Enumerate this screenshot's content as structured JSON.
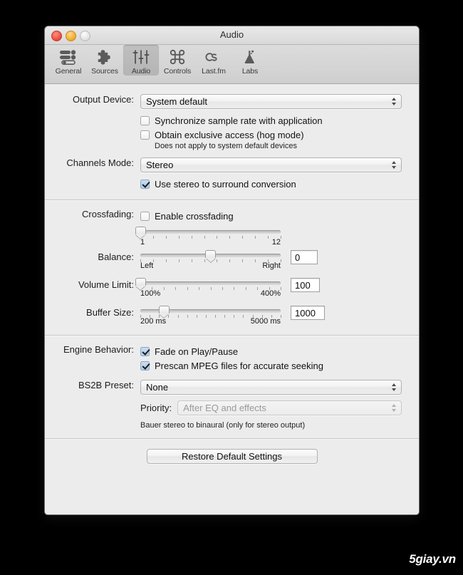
{
  "window": {
    "title": "Audio",
    "controls": {
      "close": "close-button",
      "minimize": "minimize-button",
      "zoom": "zoom-button"
    }
  },
  "toolbar": {
    "items": [
      {
        "label": "General",
        "icon": "sliders-icon",
        "selected": false
      },
      {
        "label": "Sources",
        "icon": "puzzle-piece-icon",
        "selected": false
      },
      {
        "label": "Audio",
        "icon": "faders-icon",
        "selected": true
      },
      {
        "label": "Controls",
        "icon": "command-key-icon",
        "selected": false
      },
      {
        "label": "Last.fm",
        "icon": "lastfm-logo-icon",
        "selected": false
      },
      {
        "label": "Labs",
        "icon": "flask-icon",
        "selected": false
      }
    ]
  },
  "sections": {
    "device": {
      "output_device_label": "Output Device:",
      "output_device_value": "System default",
      "sync_sample_rate_label": "Synchronize sample rate with application",
      "sync_sample_rate_checked": false,
      "hog_mode_label": "Obtain exclusive access (hog mode)",
      "hog_mode_checked": false,
      "hog_mode_hint": "Does not apply to system default devices",
      "channels_mode_label": "Channels Mode:",
      "channels_mode_value": "Stereo",
      "surround_label": "Use stereo to surround conversion",
      "surround_checked": true
    },
    "mixing": {
      "crossfading_label": "Crossfading:",
      "enable_crossfading_label": "Enable crossfading",
      "enable_crossfading_checked": false,
      "crossfade_min": "1",
      "crossfade_max": "12",
      "crossfade_percent": 0,
      "balance_label": "Balance:",
      "balance_left": "Left",
      "balance_right": "Right",
      "balance_percent": 50,
      "balance_value": "0",
      "volume_limit_label": "Volume Limit:",
      "volume_min": "100%",
      "volume_max": "400%",
      "volume_percent": 0,
      "volume_value": "100",
      "buffer_size_label": "Buffer Size:",
      "buffer_min": "200 ms",
      "buffer_max": "5000 ms",
      "buffer_percent": 17,
      "buffer_value": "1000"
    },
    "engine": {
      "engine_behavior_label": "Engine Behavior:",
      "fade_label": "Fade on Play/Pause",
      "fade_checked": true,
      "prescan_label": "Prescan MPEG files for accurate seeking",
      "prescan_checked": true,
      "bs2b_label": "BS2B Preset:",
      "bs2b_value": "None",
      "priority_label": "Priority:",
      "priority_value": "After EQ and effects",
      "priority_disabled": true,
      "bs2b_hint": "Bauer stereo to binaural (only for stereo output)"
    },
    "footer": {
      "restore_label": "Restore Default Settings"
    }
  },
  "watermark": {
    "text": "5giay.vn"
  }
}
